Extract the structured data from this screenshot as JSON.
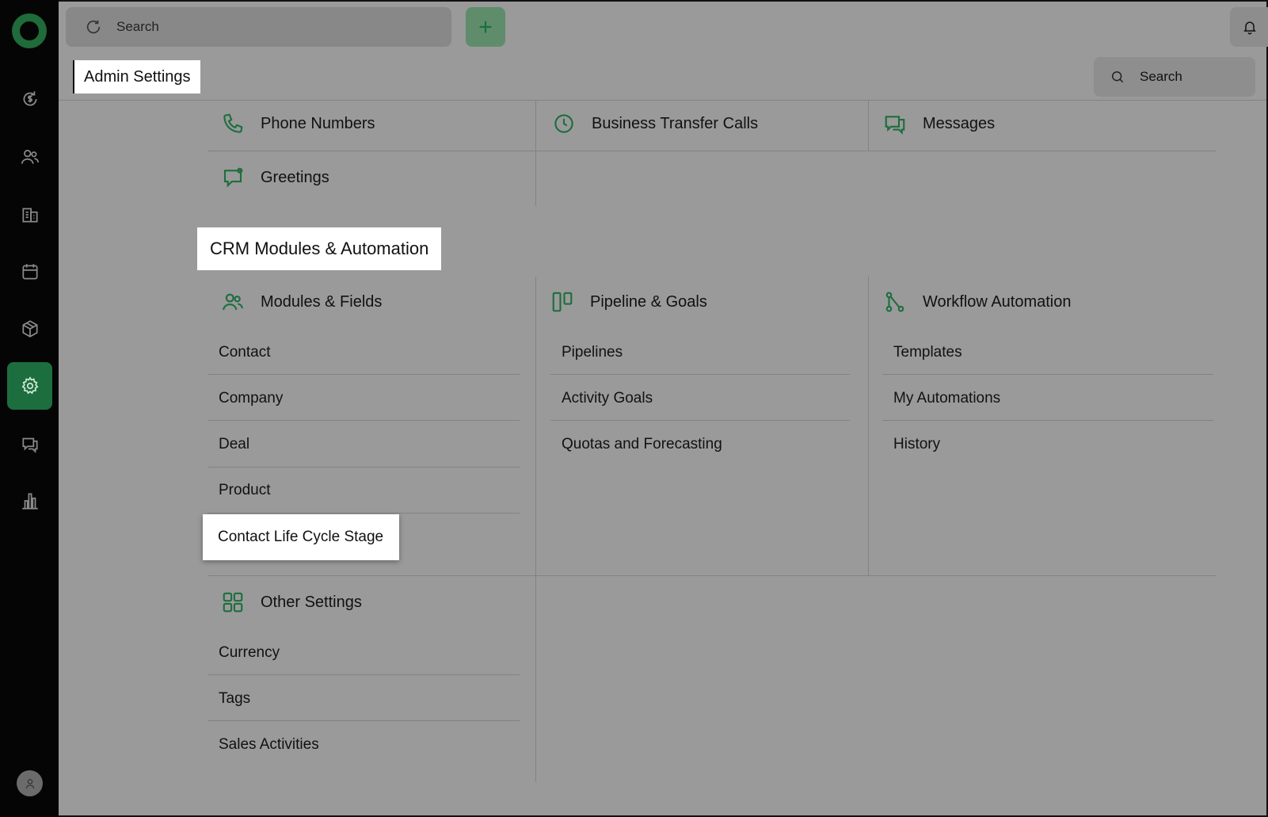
{
  "topbar": {
    "search_label": "Search"
  },
  "page": {
    "title": "Admin Settings",
    "search_label": "Search"
  },
  "channels": [
    {
      "label": "Phone Numbers",
      "icon": "phone-icon"
    },
    {
      "label": "Business Transfer Calls",
      "icon": "clock-icon"
    },
    {
      "label": "Messages",
      "icon": "messages-icon"
    },
    {
      "label": "Greetings",
      "icon": "greetings-icon"
    }
  ],
  "crm": {
    "section_title": "CRM Modules & Automation",
    "modules": {
      "heading": "Modules & Fields",
      "items": [
        "Contact",
        "Company",
        "Deal",
        "Product",
        "Contact Life Cycle Stage"
      ]
    },
    "pipeline": {
      "heading": "Pipeline & Goals",
      "items": [
        "Pipelines",
        "Activity Goals",
        "Quotas and Forecasting"
      ]
    },
    "workflow": {
      "heading": "Workflow Automation",
      "items": [
        "Templates",
        "My Automations",
        "History"
      ]
    }
  },
  "other": {
    "heading": "Other Settings",
    "items": [
      "Currency",
      "Tags",
      "Sales Activities"
    ]
  },
  "colors": {
    "accent": "#1d6e3e",
    "overlay": "#999999",
    "rail": "#050505"
  }
}
